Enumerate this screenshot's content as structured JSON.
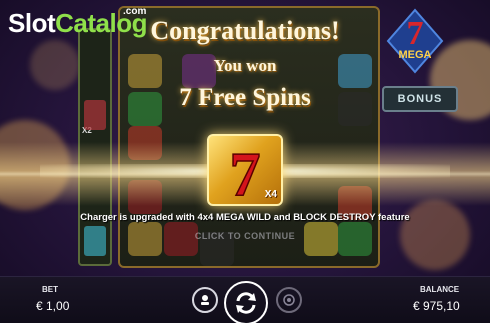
{
  "logo": {
    "brand_part1": "Slot",
    "brand_part2": "Catalog",
    "suffix": ".com"
  },
  "badges": {
    "mega_digit": "7",
    "mega_text": "MEGA",
    "bonus_label": "BONUS"
  },
  "popup": {
    "title": "Congratulations!",
    "subtitle": "You won",
    "spins": "7 Free Spins",
    "symbol_digit": "7",
    "symbol_multiplier": "X4",
    "feature_text": "Charger is upgraded with 4x4 MEGA WILD and BLOCK DESTROY feature",
    "cta": "CLICK TO CONTINUE"
  },
  "reels": {
    "side_multiplier": "X2"
  },
  "bottom_bar": {
    "bet_label": "BET",
    "bet_value": "€ 1,00",
    "balance_label": "BALANCE",
    "balance_value": "€ 975,10"
  },
  "colors": {
    "accent_gold": "#e0a21e",
    "seven_red": "#d4141c",
    "logo_green": "#8fe04a",
    "background": "#24143a"
  },
  "icons": [
    "autoplay-icon",
    "spin-icon",
    "turbo-icon",
    "seven-icon"
  ]
}
